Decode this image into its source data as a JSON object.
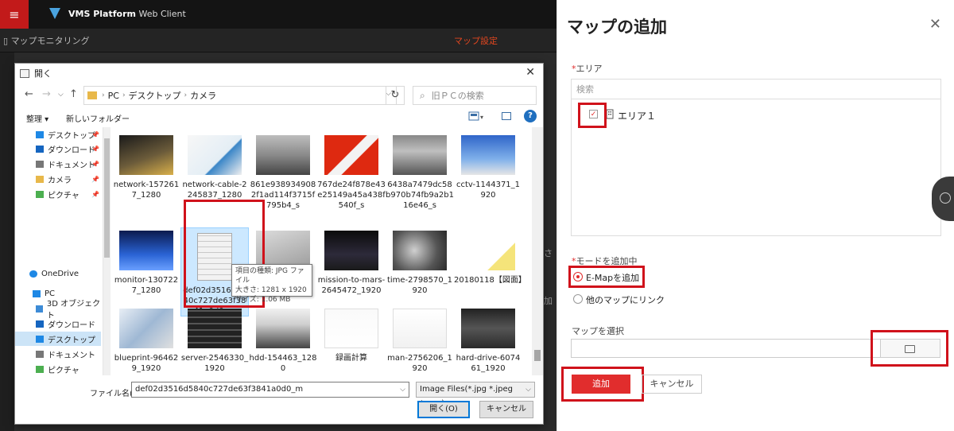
{
  "app": {
    "menu_icon": "hamburger-icon",
    "brand": "VMS Platform",
    "subtitle": "Web Client",
    "map_monitoring": "マップモニタリング",
    "map_settings": "マップ設定",
    "bg_text_1": "さ",
    "bg_text_2": "加"
  },
  "dialog": {
    "title": "開く",
    "address": [
      "PC",
      "デスクトップ",
      "カメラ"
    ],
    "search_placeholder": "旧ＰＣの検索",
    "organize": "整理 ▾",
    "new_folder": "新しいフォルダー",
    "nav": [
      {
        "label": "デスクトップ",
        "pinned": true
      },
      {
        "label": "ダウンロード",
        "pinned": true
      },
      {
        "label": "ドキュメント",
        "pinned": true
      },
      {
        "label": "カメラ",
        "pinned": true
      },
      {
        "label": "ピクチャ",
        "pinned": true
      },
      {
        "label": "OneDrive",
        "pinned": false
      },
      {
        "label": "PC",
        "pinned": false
      },
      {
        "label": "3D オブジェクト",
        "pinned": false
      },
      {
        "label": "ダウンロード",
        "pinned": false
      },
      {
        "label": "デスクトップ",
        "pinned": false
      },
      {
        "label": "ドキュメント",
        "pinned": false
      },
      {
        "label": "ピクチャ",
        "pinned": false
      }
    ],
    "files": [
      {
        "name": "network-1572617_1280"
      },
      {
        "name": "network-cable-2245837_1280"
      },
      {
        "name": "861e9389349082f1ad114f3715f795b4_s"
      },
      {
        "name": "767de24f878e43e25149a45a438f540f_s"
      },
      {
        "name": "6438a7479dc58b970b74fb9a2b116e46_s"
      },
      {
        "name": "cctv-1144371_1920"
      },
      {
        "name": "monitor-1307227_1280"
      },
      {
        "name": "def02d3516d5840c727de63f3841a0d0_m"
      },
      {
        "name": "...50"
      },
      {
        "name": "mission-to-mars-2645472_1920"
      },
      {
        "name": "time-2798570_1920"
      },
      {
        "name": "20180118【図面】"
      },
      {
        "name": "blueprint-964629_1920"
      },
      {
        "name": "server-2546330_1920"
      },
      {
        "name": "hdd-154463_1280"
      },
      {
        "name": "録画計算"
      },
      {
        "name": "man-2756206_1920"
      },
      {
        "name": "hard-drive-607461_1920"
      }
    ],
    "tooltip": {
      "type": "項目の種類: JPG ファイル",
      "dims": "大きさ: 1281 x 1920",
      "size": "サイズ: 1.06 MB"
    },
    "filename_label": "ファイル名(N):",
    "filename_value": "def02d3516d5840c727de63f3841a0d0_m",
    "filter": "Image Files(*.jpg *.jpeg *.png)",
    "open": "開く(O)",
    "cancel": "キャンセル",
    "help": "?"
  },
  "panel": {
    "title": "マップの追加",
    "area_label": "エリア",
    "area_search_placeholder": "検索",
    "area_item": "エリア１",
    "mode_label": "モードを追加中",
    "mode_emap": "E-Mapを追加",
    "mode_link": "他のマップにリンク",
    "select_label": "マップを選択",
    "add": "追加",
    "cancel": "キャンセル",
    "required_mark": "*",
    "close": "✕"
  },
  "colors": {
    "accent_red": "#e12d2d",
    "highlight_box": "#d0121b",
    "map_settings": "#e0461f",
    "menu_red": "#c21a1a"
  }
}
